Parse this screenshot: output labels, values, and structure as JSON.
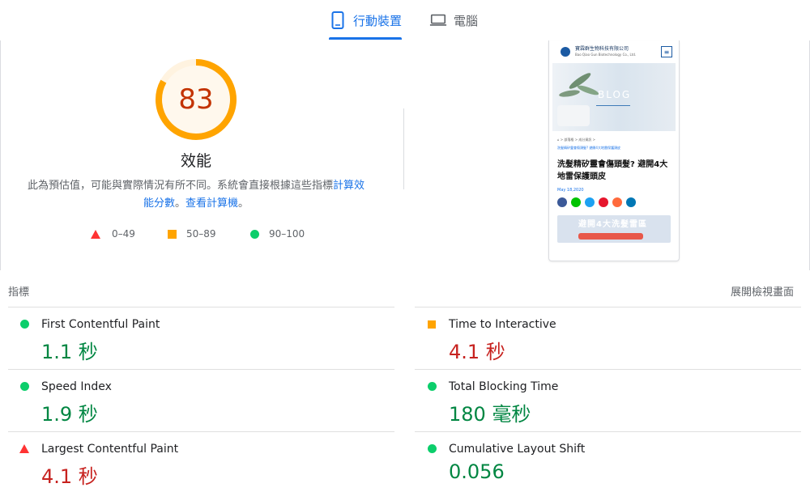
{
  "tabs": {
    "mobile_label": "行動裝置",
    "desktop_label": "電腦"
  },
  "performance": {
    "score": "83",
    "score_value": 83,
    "title": "效能",
    "description": "此為預估值，可能與實際情況有所不同。系統會直接根據這些指標",
    "link_calc": "計算效能分數",
    "separator": "。",
    "link_calculator": "查看計算機",
    "end": "。",
    "colors": {
      "ring": "#ffa400",
      "ring_bg": "#fff3e0",
      "score": "#c33300"
    }
  },
  "legend": {
    "red_range": "0–49",
    "orange_range": "50–89",
    "green_range": "90–100"
  },
  "screenshot": {
    "company_name": "寶霖群生物科技有限公司",
    "company_sub": "Bao Qiao Gun Biotechnology Co., Ltd.",
    "hero_word": "BLOG",
    "breadcrumb": "⌂  >  部落格  >  成分資訊  >",
    "breadcrumb_current": "洗髮精矽靈會傷頭髮? 避開4大地雷保護頭皮",
    "article_title": "洗髮精矽靈會傷頭髮? 避開4大地雷保護頭皮",
    "date": "May 18,2020",
    "banner_text": "避開4大洗髮雷區"
  },
  "metrics": {
    "label": "指標",
    "expand": "展開檢視畫面",
    "items": [
      {
        "name": "First Contentful Paint",
        "value": "1.1 秒",
        "status": "good"
      },
      {
        "name": "Time to Interactive",
        "value": "4.1 秒",
        "status": "average"
      },
      {
        "name": "Speed Index",
        "value": "1.9 秒",
        "status": "good"
      },
      {
        "name": "Total Blocking Time",
        "value": "180 毫秒",
        "status": "good"
      },
      {
        "name": "Largest Contentful Paint",
        "value": "4.1 秒",
        "status": "poor"
      },
      {
        "name": "Cumulative Layout Shift",
        "value": "0.056",
        "status": "good"
      }
    ]
  }
}
